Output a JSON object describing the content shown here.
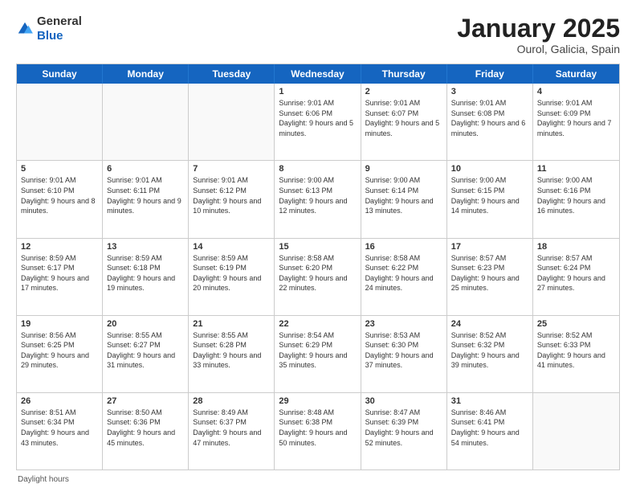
{
  "header": {
    "logo_general": "General",
    "logo_blue": "Blue",
    "month_title": "January 2025",
    "location": "Ourol, Galicia, Spain"
  },
  "weekdays": [
    "Sunday",
    "Monday",
    "Tuesday",
    "Wednesday",
    "Thursday",
    "Friday",
    "Saturday"
  ],
  "footer": {
    "daylight_label": "Daylight hours"
  },
  "rows": [
    [
      {
        "day": "",
        "text": ""
      },
      {
        "day": "",
        "text": ""
      },
      {
        "day": "",
        "text": ""
      },
      {
        "day": "1",
        "text": "Sunrise: 9:01 AM\nSunset: 6:06 PM\nDaylight: 9 hours and 5 minutes."
      },
      {
        "day": "2",
        "text": "Sunrise: 9:01 AM\nSunset: 6:07 PM\nDaylight: 9 hours and 5 minutes."
      },
      {
        "day": "3",
        "text": "Sunrise: 9:01 AM\nSunset: 6:08 PM\nDaylight: 9 hours and 6 minutes."
      },
      {
        "day": "4",
        "text": "Sunrise: 9:01 AM\nSunset: 6:09 PM\nDaylight: 9 hours and 7 minutes."
      }
    ],
    [
      {
        "day": "5",
        "text": "Sunrise: 9:01 AM\nSunset: 6:10 PM\nDaylight: 9 hours and 8 minutes."
      },
      {
        "day": "6",
        "text": "Sunrise: 9:01 AM\nSunset: 6:11 PM\nDaylight: 9 hours and 9 minutes."
      },
      {
        "day": "7",
        "text": "Sunrise: 9:01 AM\nSunset: 6:12 PM\nDaylight: 9 hours and 10 minutes."
      },
      {
        "day": "8",
        "text": "Sunrise: 9:00 AM\nSunset: 6:13 PM\nDaylight: 9 hours and 12 minutes."
      },
      {
        "day": "9",
        "text": "Sunrise: 9:00 AM\nSunset: 6:14 PM\nDaylight: 9 hours and 13 minutes."
      },
      {
        "day": "10",
        "text": "Sunrise: 9:00 AM\nSunset: 6:15 PM\nDaylight: 9 hours and 14 minutes."
      },
      {
        "day": "11",
        "text": "Sunrise: 9:00 AM\nSunset: 6:16 PM\nDaylight: 9 hours and 16 minutes."
      }
    ],
    [
      {
        "day": "12",
        "text": "Sunrise: 8:59 AM\nSunset: 6:17 PM\nDaylight: 9 hours and 17 minutes."
      },
      {
        "day": "13",
        "text": "Sunrise: 8:59 AM\nSunset: 6:18 PM\nDaylight: 9 hours and 19 minutes."
      },
      {
        "day": "14",
        "text": "Sunrise: 8:59 AM\nSunset: 6:19 PM\nDaylight: 9 hours and 20 minutes."
      },
      {
        "day": "15",
        "text": "Sunrise: 8:58 AM\nSunset: 6:20 PM\nDaylight: 9 hours and 22 minutes."
      },
      {
        "day": "16",
        "text": "Sunrise: 8:58 AM\nSunset: 6:22 PM\nDaylight: 9 hours and 24 minutes."
      },
      {
        "day": "17",
        "text": "Sunrise: 8:57 AM\nSunset: 6:23 PM\nDaylight: 9 hours and 25 minutes."
      },
      {
        "day": "18",
        "text": "Sunrise: 8:57 AM\nSunset: 6:24 PM\nDaylight: 9 hours and 27 minutes."
      }
    ],
    [
      {
        "day": "19",
        "text": "Sunrise: 8:56 AM\nSunset: 6:25 PM\nDaylight: 9 hours and 29 minutes."
      },
      {
        "day": "20",
        "text": "Sunrise: 8:55 AM\nSunset: 6:27 PM\nDaylight: 9 hours and 31 minutes."
      },
      {
        "day": "21",
        "text": "Sunrise: 8:55 AM\nSunset: 6:28 PM\nDaylight: 9 hours and 33 minutes."
      },
      {
        "day": "22",
        "text": "Sunrise: 8:54 AM\nSunset: 6:29 PM\nDaylight: 9 hours and 35 minutes."
      },
      {
        "day": "23",
        "text": "Sunrise: 8:53 AM\nSunset: 6:30 PM\nDaylight: 9 hours and 37 minutes."
      },
      {
        "day": "24",
        "text": "Sunrise: 8:52 AM\nSunset: 6:32 PM\nDaylight: 9 hours and 39 minutes."
      },
      {
        "day": "25",
        "text": "Sunrise: 8:52 AM\nSunset: 6:33 PM\nDaylight: 9 hours and 41 minutes."
      }
    ],
    [
      {
        "day": "26",
        "text": "Sunrise: 8:51 AM\nSunset: 6:34 PM\nDaylight: 9 hours and 43 minutes."
      },
      {
        "day": "27",
        "text": "Sunrise: 8:50 AM\nSunset: 6:36 PM\nDaylight: 9 hours and 45 minutes."
      },
      {
        "day": "28",
        "text": "Sunrise: 8:49 AM\nSunset: 6:37 PM\nDaylight: 9 hours and 47 minutes."
      },
      {
        "day": "29",
        "text": "Sunrise: 8:48 AM\nSunset: 6:38 PM\nDaylight: 9 hours and 50 minutes."
      },
      {
        "day": "30",
        "text": "Sunrise: 8:47 AM\nSunset: 6:39 PM\nDaylight: 9 hours and 52 minutes."
      },
      {
        "day": "31",
        "text": "Sunrise: 8:46 AM\nSunset: 6:41 PM\nDaylight: 9 hours and 54 minutes."
      },
      {
        "day": "",
        "text": ""
      }
    ]
  ]
}
